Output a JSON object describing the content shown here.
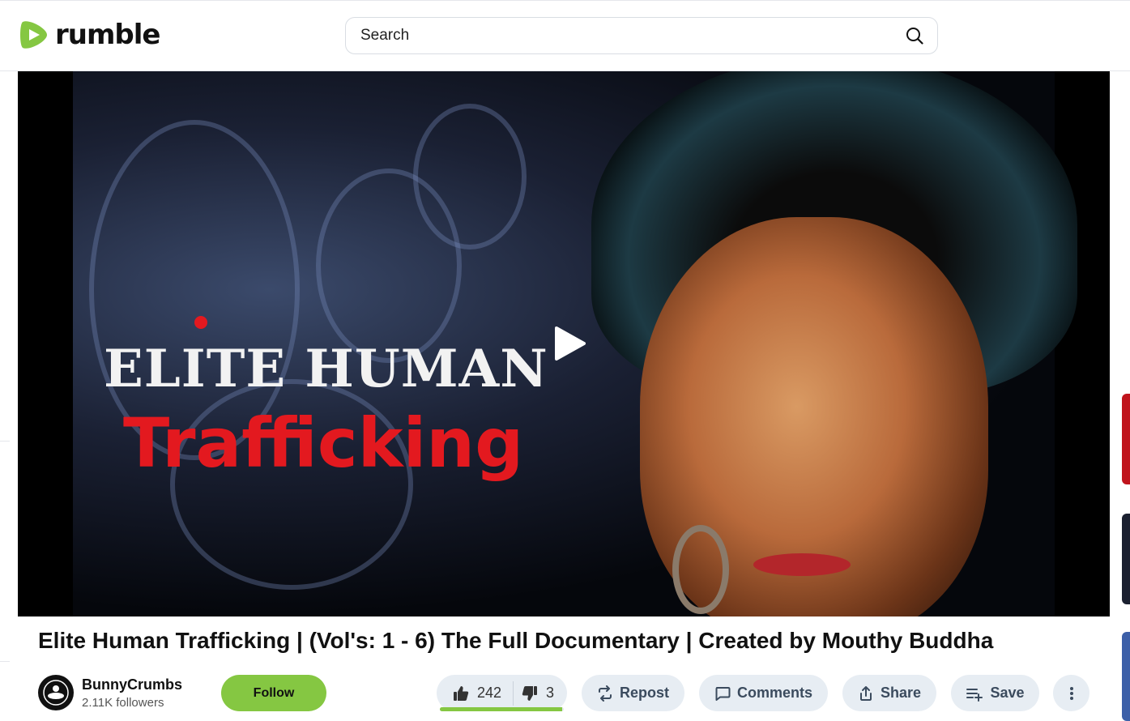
{
  "brand": {
    "name": "rumble",
    "accent": "#85c742"
  },
  "search": {
    "placeholder": "Search",
    "icon": "search-icon"
  },
  "player": {
    "overlay_line1": "ELITE HUMAN",
    "overlay_line2": "Trafficking",
    "play_icon": "play-icon"
  },
  "video": {
    "title": "Elite Human Trafficking | (Vol's: 1 - 6) The Full Documentary | Created by Mouthy Buddha"
  },
  "channel": {
    "name": "BunnyCrumbs",
    "followers": "2.11K followers"
  },
  "actions": {
    "follow_label": "Follow",
    "likes": "242",
    "dislikes": "3",
    "like_ratio": 0.988,
    "repost_label": "Repost",
    "comments_label": "Comments",
    "share_label": "Share",
    "save_label": "Save",
    "more_icon": "kebab-menu-icon"
  }
}
